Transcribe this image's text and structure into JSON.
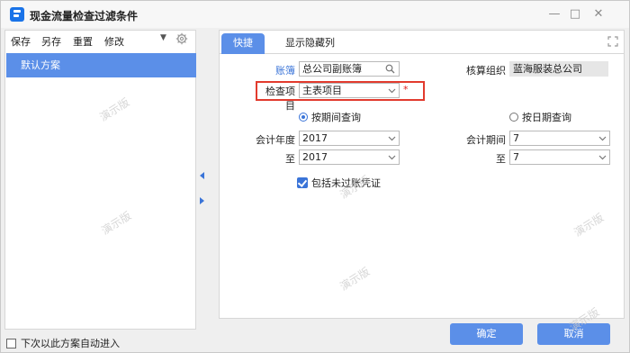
{
  "window": {
    "title": "现金流量检查过滤条件",
    "controls": [
      "—",
      "□",
      "✕"
    ]
  },
  "left": {
    "toolbar": [
      "保存",
      "另存",
      "重置",
      "修改"
    ],
    "schemes": [
      "默认方案"
    ],
    "auto_enter_label": "下次以此方案自动进入"
  },
  "tabs": [
    "快捷",
    "显示隐藏列"
  ],
  "form": {
    "ledger_label": "账簿",
    "ledger_value": "总公司副账簿",
    "org_label": "核算组织",
    "org_value": "蓝海服装总公司",
    "check_item_label": "检查项目",
    "check_item_value": "主表项目",
    "required_mark": "*",
    "radio_period": "按期间查询",
    "radio_date": "按日期查询",
    "year_label": "会计年度",
    "year_from": "2017",
    "to_label": "至",
    "year_to": "2017",
    "period_label": "会计期间",
    "period_from": "7",
    "to_label_2": "至",
    "period_to": "7",
    "include_unposted": "包括未过账凭证"
  },
  "buttons": {
    "ok": "确定",
    "cancel": "取消"
  },
  "watermark": "演示版",
  "colors": {
    "accent": "#5b8fe8",
    "link": "#3a74d8",
    "required": "#e02020",
    "highlight": "#e23b2e"
  }
}
